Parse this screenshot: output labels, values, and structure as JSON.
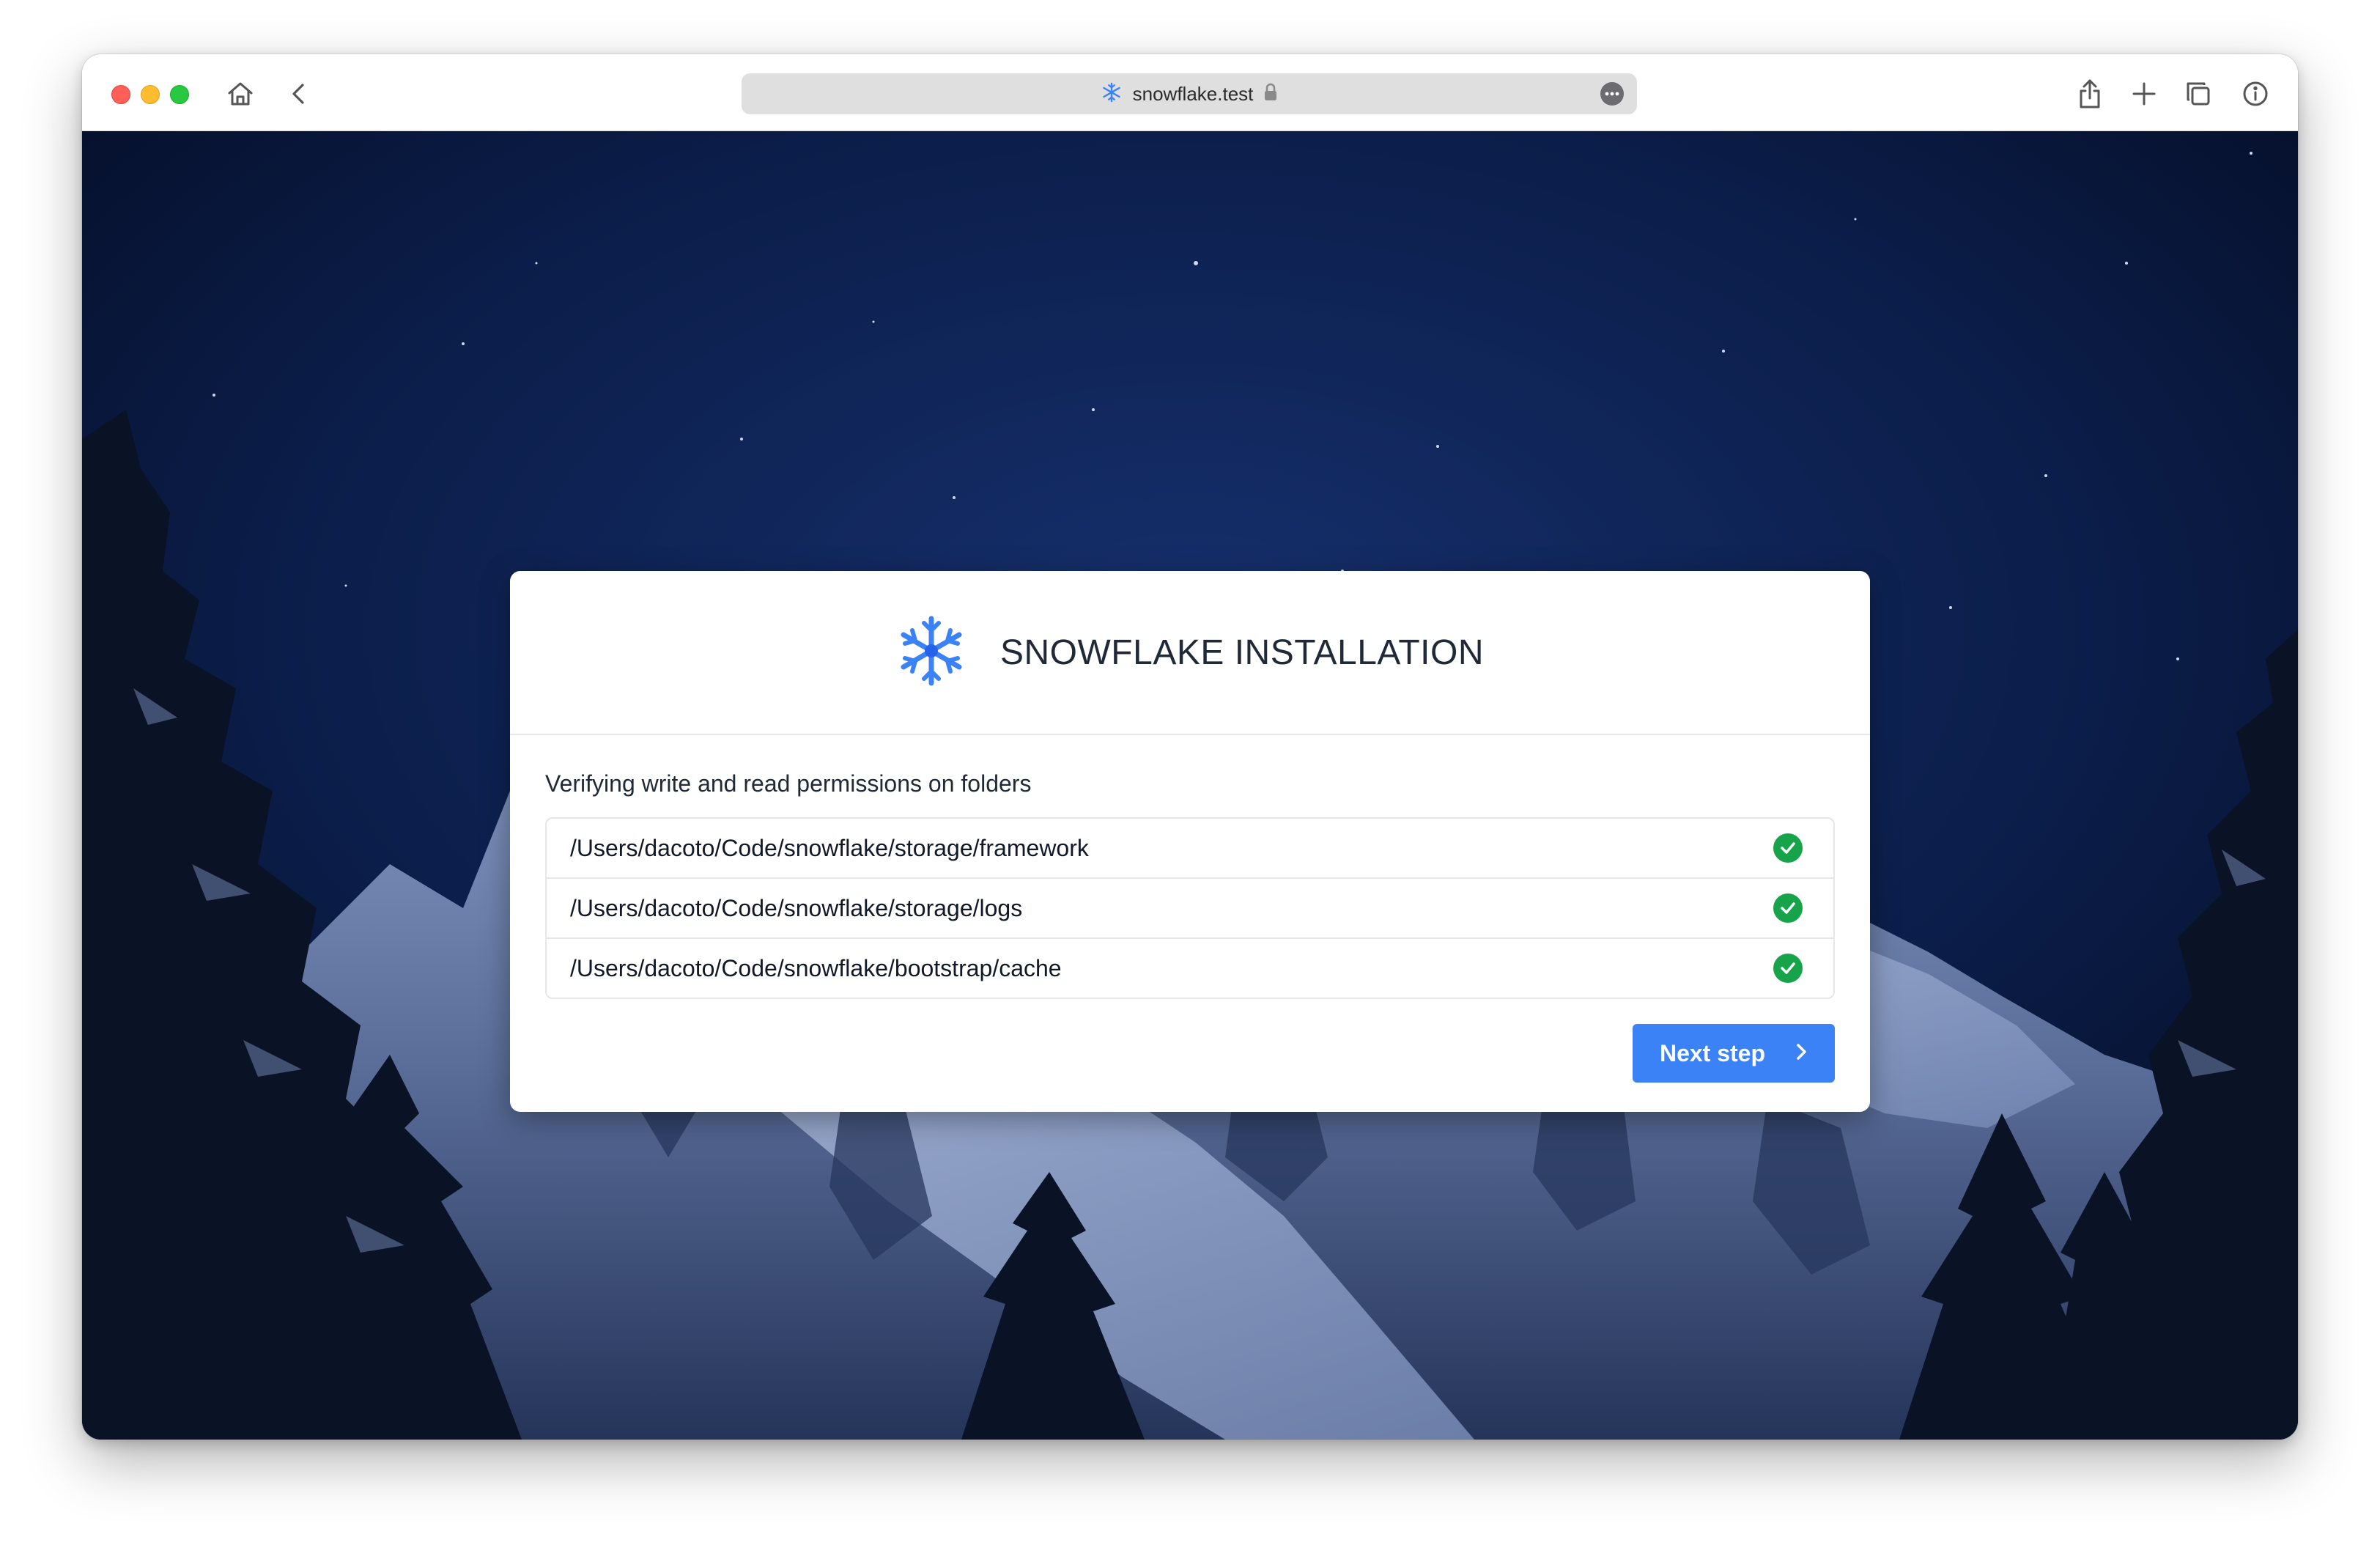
{
  "browser": {
    "url": "snowflake.test",
    "icons": [
      "close-light",
      "minimize-light",
      "zoom-light",
      "home-icon",
      "back-icon",
      "snowflake-favicon-icon",
      "lock-icon",
      "more-icon",
      "share-icon",
      "new-tab-icon",
      "tabs-overview-icon",
      "info-icon"
    ]
  },
  "installer": {
    "title": "SNOWFLAKE INSTALLATION",
    "subtitle": "Verifying write and read permissions on folders",
    "folders": [
      {
        "path": "/Users/dacoto/Code/snowflake/storage/framework",
        "status": "ok"
      },
      {
        "path": "/Users/dacoto/Code/snowflake/storage/logs",
        "status": "ok"
      },
      {
        "path": "/Users/dacoto/Code/snowflake/bootstrap/cache",
        "status": "ok"
      }
    ],
    "next_label": "Next step"
  },
  "colors": {
    "accent": "#3b82f6",
    "success": "#16a34a",
    "logo": "#3b82f6",
    "background_sky": "#06122d"
  }
}
